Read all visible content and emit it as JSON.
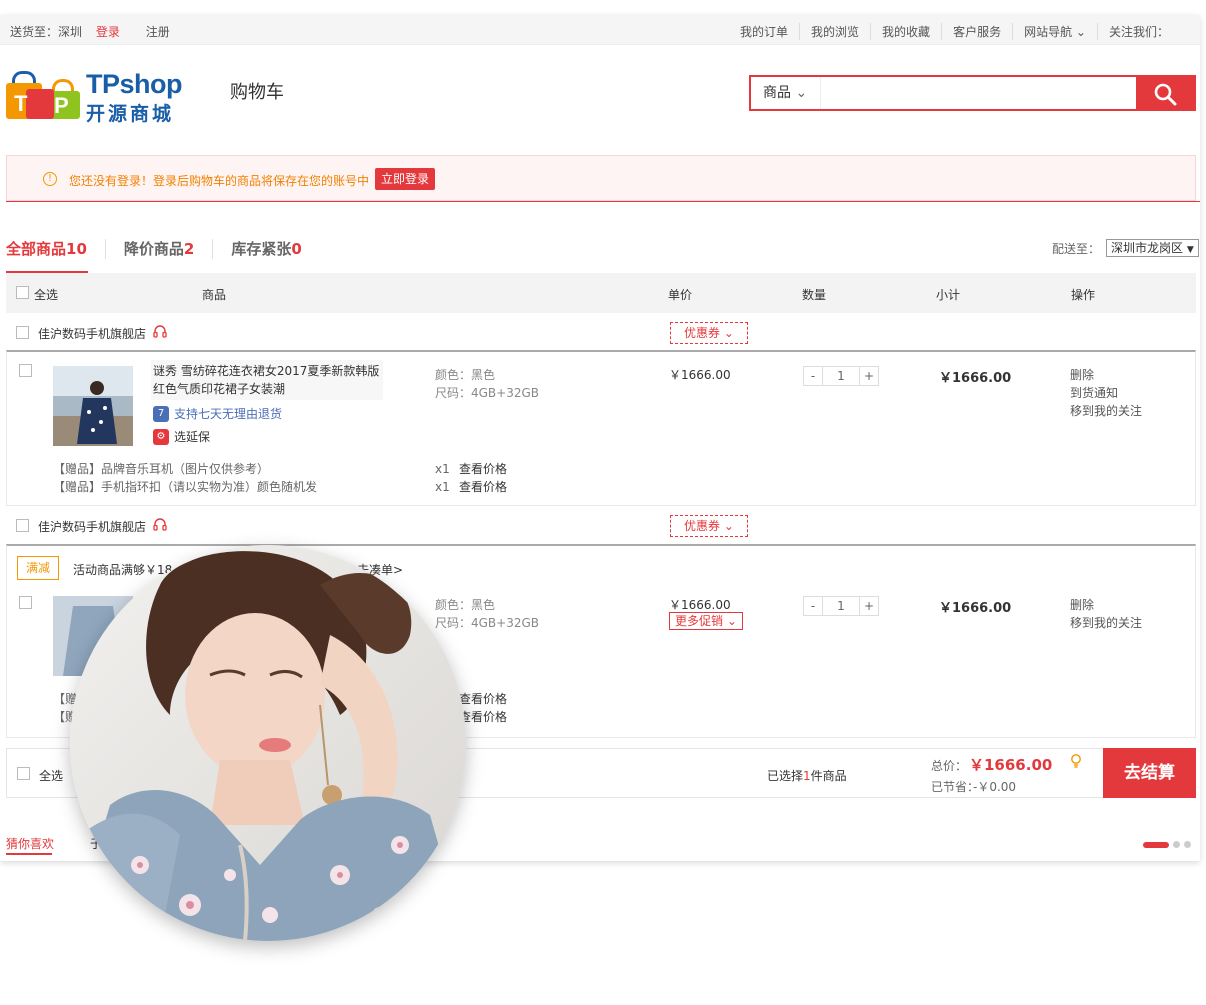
{
  "topbar": {
    "deliver_label": "送货至：",
    "city": "深圳",
    "login": "登录",
    "register": "注册",
    "links": [
      "我的订单",
      "我的浏览",
      "我的收藏",
      "客户服务",
      "网站导航",
      "关注我们："
    ]
  },
  "header": {
    "logo_name": "TPshop",
    "logo_sub": "开源商城",
    "page_title": "购物车",
    "search_category": "商品",
    "search_placeholder": ""
  },
  "notice": {
    "text": "您还没有登录！登录后购物车的商品将保存在您的账号中",
    "button": "立即登录"
  },
  "tabs": [
    {
      "label": "全部商品",
      "count": "10"
    },
    {
      "label": "降价商品",
      "count": "2"
    },
    {
      "label": "库存紧张",
      "count": "0"
    }
  ],
  "deliver": {
    "label": "配送至：",
    "value": "深圳市龙岗区"
  },
  "table_header": {
    "select_all": "全选",
    "product": "商品",
    "unit_price": "单价",
    "quantity": "数量",
    "subtotal": "小计",
    "action": "操作"
  },
  "shops": [
    {
      "name": "佳沪数码手机旗舰店",
      "coupon": "优惠券"
    },
    {
      "name": "佳沪数码手机旗舰店",
      "coupon": "优惠券"
    }
  ],
  "items": [
    {
      "title": "谜秀 雪纺碎花连衣裙女2017夏季新款韩版红色气质印花裙子女装潮",
      "color": "颜色：黑色",
      "size": "尺码：4GB+32GB",
      "price": "￥1666.00",
      "qty": "1",
      "subtotal": "￥1666.00",
      "ops": [
        "删除",
        "到货通知",
        "移到我的关注"
      ],
      "service_return": "支持七天无理由退货",
      "service_warranty": "选延保",
      "gifts": [
        {
          "name": "【赠品】品牌音乐耳机（图片仅供参考）",
          "qty": "x1",
          "link": "查看价格"
        },
        {
          "name": "【赠品】手机指环扣（请以实物为准）颜色随机发",
          "qty": "x1",
          "link": "查看价格"
        }
      ]
    },
    {
      "promo_tag": "满减",
      "promo_text": "活动商品满够￥18",
      "promo_link": "去凑单>",
      "color": "颜色：黑色",
      "size": "尺码：4GB+32GB",
      "price": "￥1666.00",
      "more_promo": "更多促销",
      "qty": "1",
      "subtotal": "￥1666.00",
      "ops": [
        "删除",
        "移到我的关注"
      ],
      "gifts": [
        {
          "name": "【赠",
          "link": "查看价格"
        },
        {
          "name": "【赠",
          "link": "查看价格"
        }
      ]
    }
  ],
  "footer": {
    "select_all": "全选",
    "selected_prefix": "已选择",
    "selected_count": "1",
    "selected_suffix": "件商品",
    "total_label": "总价：",
    "total": "￥1666.00",
    "saved_label": "已节省：",
    "saved": "-￥0.00",
    "checkout": "去结算"
  },
  "recommend": {
    "tab_active": "猜你喜欢",
    "tab_other": "于"
  },
  "colors": {
    "accent": "#e4393c",
    "warning": "#f39800",
    "brand_blue": "#1b5ea8"
  }
}
